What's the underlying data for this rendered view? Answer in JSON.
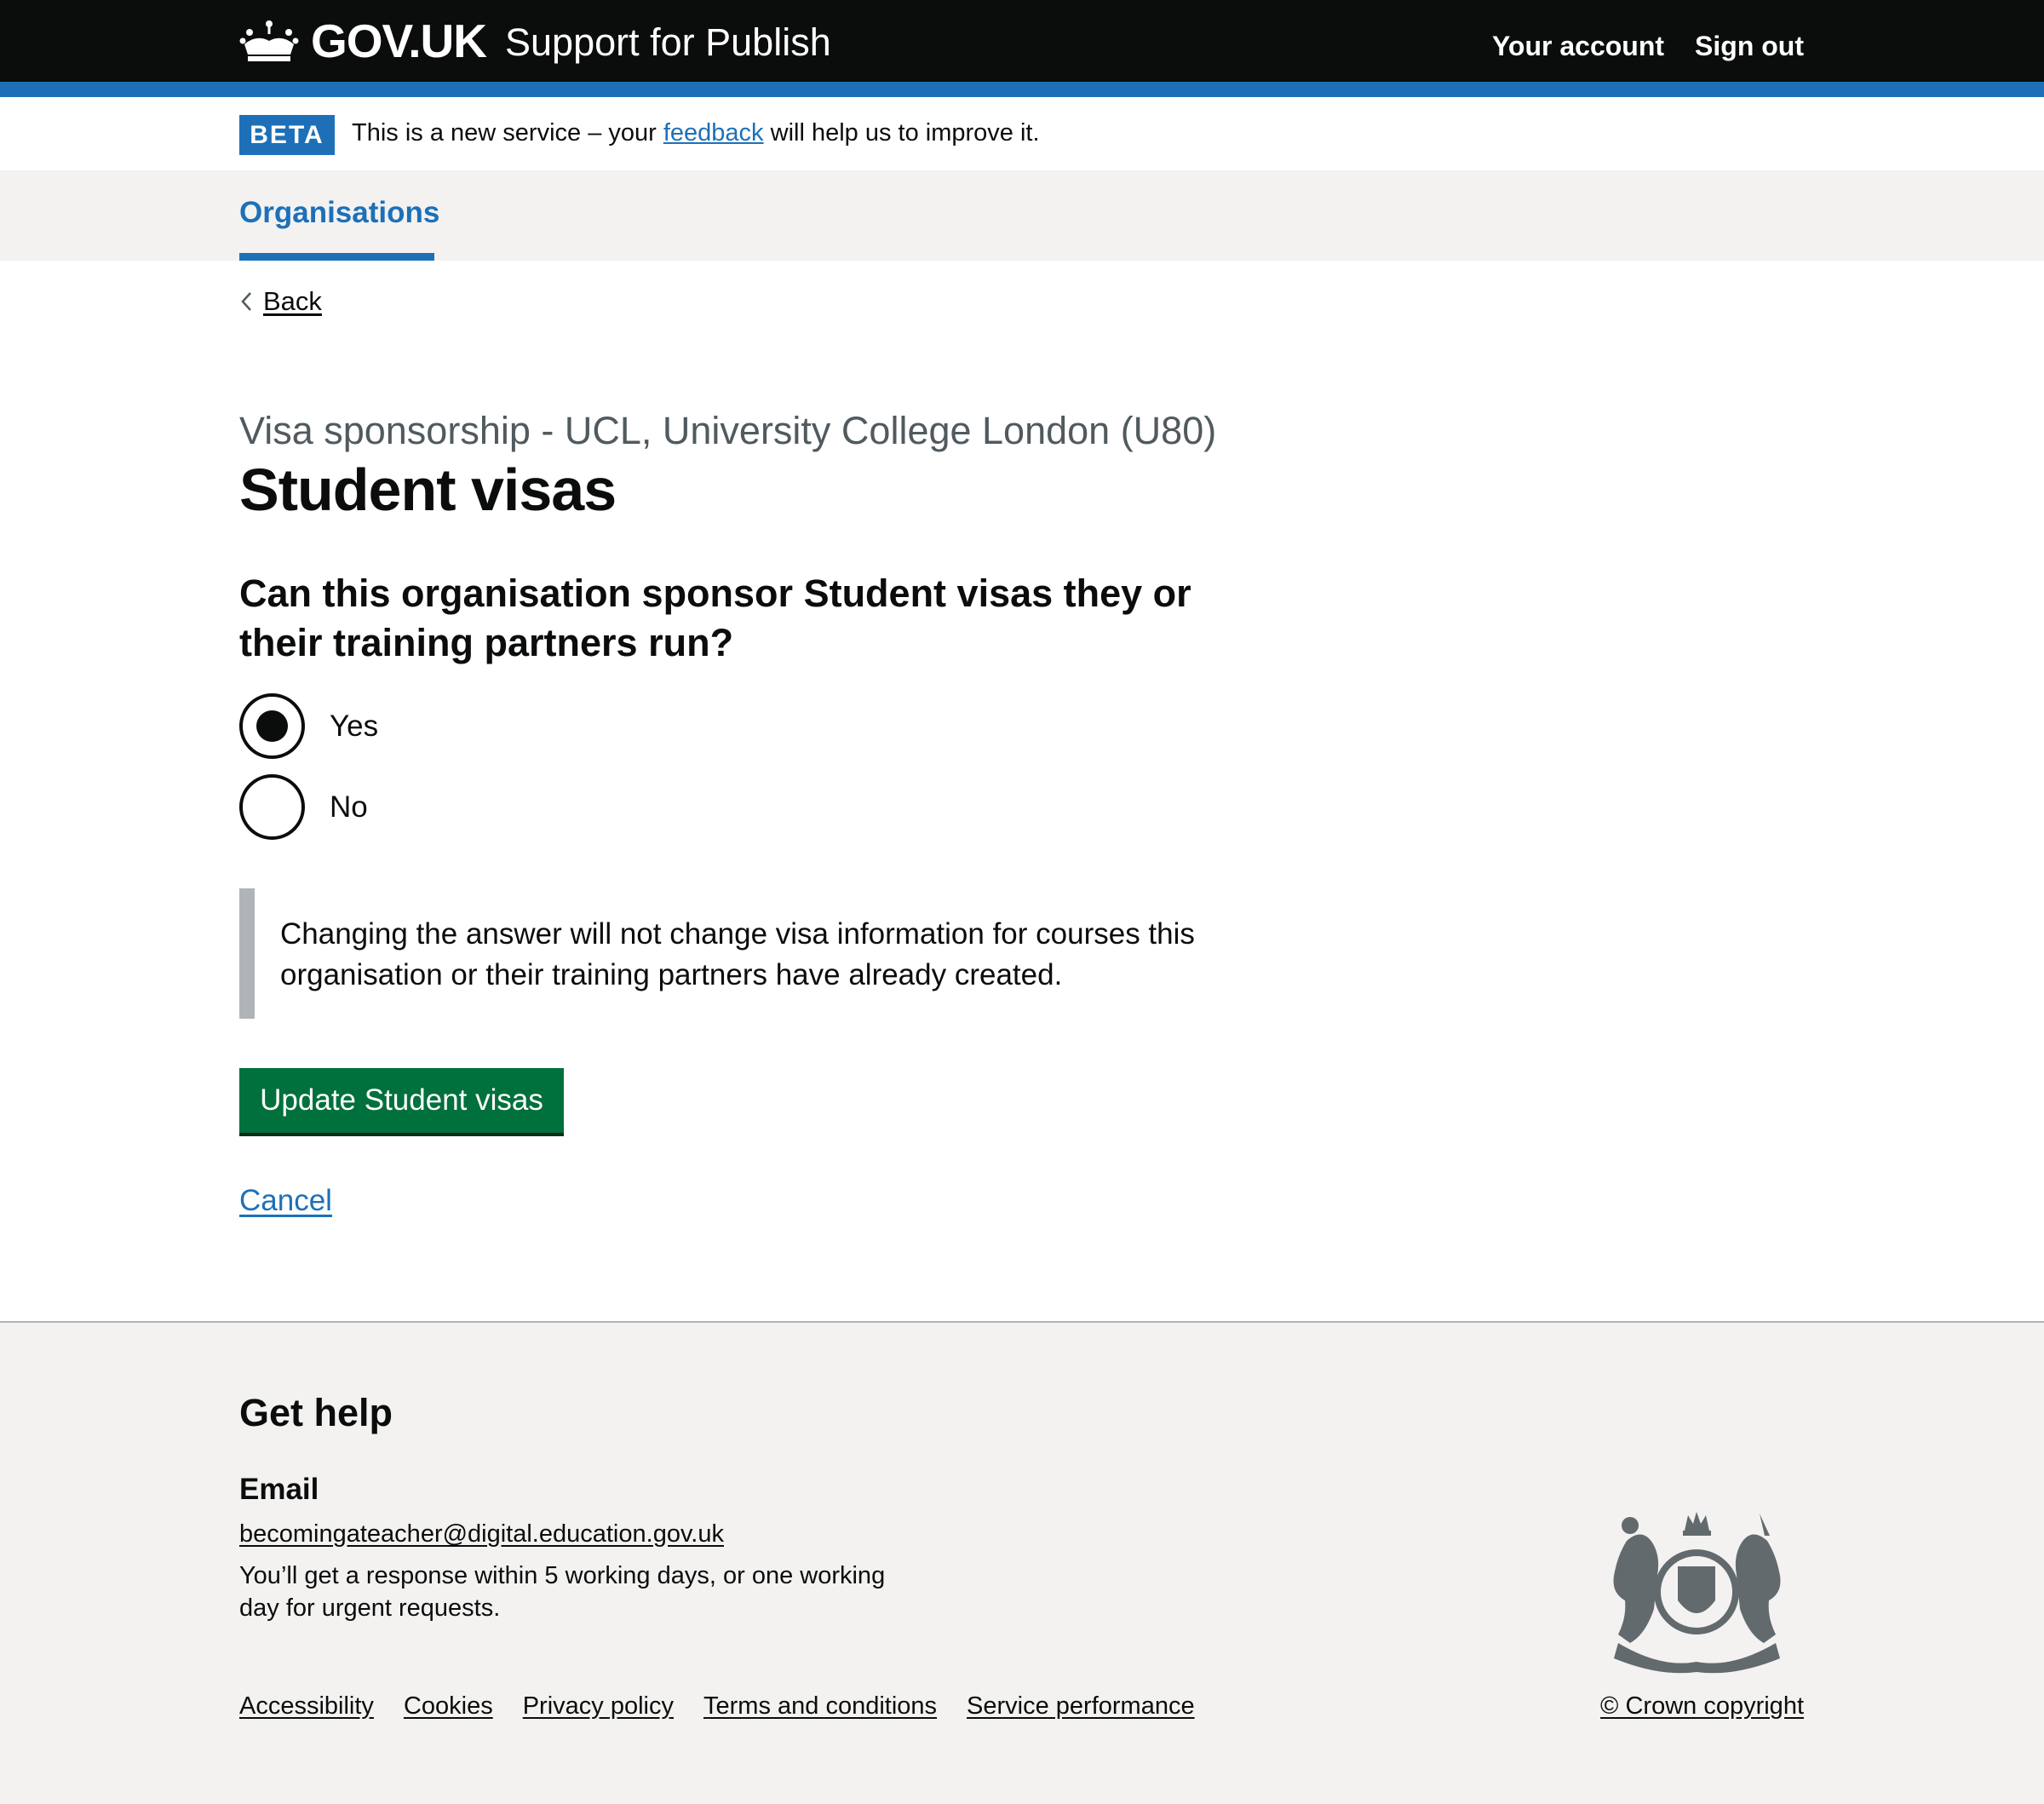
{
  "header": {
    "logo_text": "GOV.UK",
    "service_name": "Support for Publish",
    "nav": [
      "Your account",
      "Sign out"
    ]
  },
  "phase_banner": {
    "tag": "BETA",
    "text_before": "This is a new service – your ",
    "link": "feedback",
    "text_after": " will help us to improve it."
  },
  "primary_nav": {
    "items": [
      "Organisations"
    ],
    "active": "Organisations"
  },
  "back_link": "Back",
  "caption": "Visa sponsorship - UCL, University College London (U80)",
  "title": "Student visas",
  "question": "Can this organisation sponsor Student visas they or their training partners run?",
  "options": [
    {
      "label": "Yes",
      "checked": true
    },
    {
      "label": "No",
      "checked": false
    }
  ],
  "inset_text": "Changing the answer will not change visa information for courses this organisation or their training partners have already created.",
  "submit_button": "Update Student visas",
  "cancel_link": "Cancel",
  "footer": {
    "help_title": "Get help",
    "email_heading": "Email",
    "email": "becomingateacher@digital.education.gov.uk",
    "response_text": "You’ll get a response within 5 working days, or one working day for urgent requests.",
    "links": [
      "Accessibility",
      "Cookies",
      "Privacy policy",
      "Terms and conditions",
      "Service performance"
    ],
    "copyright": "© Crown copyright"
  },
  "colors": {
    "header_bg": "#0b0c0c",
    "brand_blue": "#1d70b8",
    "button_green": "#00703c",
    "footer_bg": "#f3f2f1",
    "caption_grey": "#505a5f"
  }
}
